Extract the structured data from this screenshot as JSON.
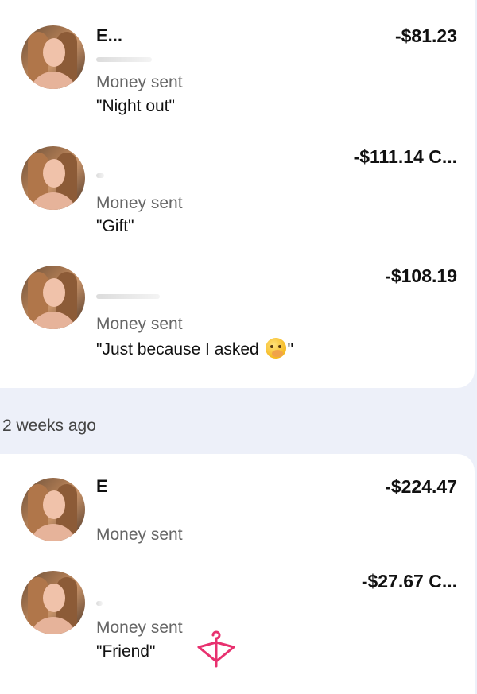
{
  "transactions_recent": [
    {
      "name": "E...",
      "amount": "-$81.23",
      "status": "Money sent",
      "note": "\"Night out\""
    },
    {
      "name": "",
      "amount": "-$111.14 C...",
      "status": "Money sent",
      "note": "\"Gift\""
    },
    {
      "name": "",
      "amount": "-$108.19",
      "status": "Money sent",
      "note_prefix": "\"Just because I asked ",
      "note_emoji": "face-with-hand-over-mouth",
      "note_suffix": "\""
    }
  ],
  "section_header": "2 weeks ago",
  "transactions_older": [
    {
      "name": "E",
      "amount": "-$224.47",
      "status": "Money sent",
      "note": ""
    },
    {
      "name": "",
      "amount": "-$27.67 C...",
      "status": "Money sent",
      "note": "\"Friend\""
    }
  ],
  "colors": {
    "page_bg": "#edf0f9",
    "card_bg": "#ffffff",
    "status_text": "#666666",
    "watermark": "#e8316f"
  },
  "icons": {
    "watermark": "hanger-bow-icon"
  }
}
